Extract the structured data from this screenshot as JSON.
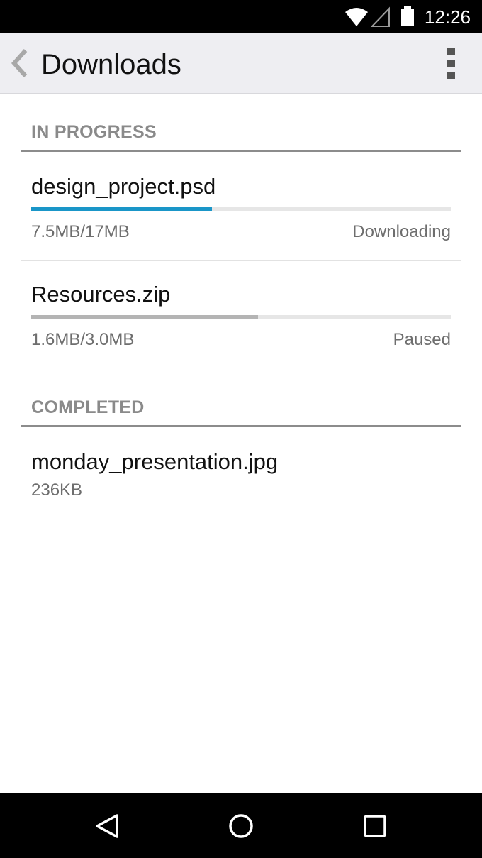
{
  "status_bar": {
    "time": "12:26",
    "icons": [
      "wifi-icon",
      "cell-signal-icon",
      "battery-icon"
    ]
  },
  "app_bar": {
    "title": "Downloads",
    "back_icon": "chevron-left-icon",
    "menu_icon": "overflow-menu-icon"
  },
  "sections": {
    "in_progress": {
      "header": "IN PROGRESS",
      "items": [
        {
          "name": "design_project.psd",
          "size": "7.5MB/17MB",
          "status": "Downloading",
          "progress": 0.431,
          "bar_color": "#1a96c8"
        },
        {
          "name": "Resources.zip",
          "size": "1.6MB/3.0MB",
          "status": "Paused",
          "progress": 0.541,
          "bar_color": "#b4b4b4"
        }
      ]
    },
    "completed": {
      "header": "COMPLETED",
      "items": [
        {
          "name": "monday_presentation.jpg",
          "size": "236KB"
        }
      ]
    }
  },
  "nav_bar": {
    "icons": [
      "back-triangle-icon",
      "home-circle-icon",
      "recents-square-icon"
    ]
  }
}
